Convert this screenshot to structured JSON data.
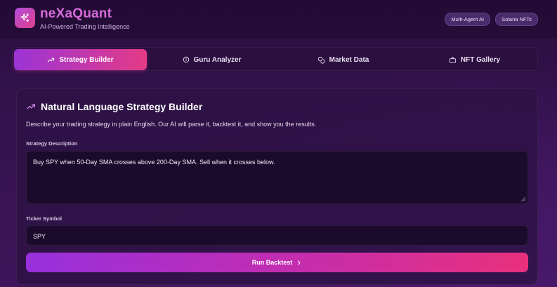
{
  "header": {
    "brand": "neXaQuant",
    "tagline": "AI-Powered Trading Intelligence",
    "logo_icon": "sparkles-icon",
    "badges": [
      "Multi-Agent AI",
      "Solana NFTs"
    ]
  },
  "tabs": [
    {
      "label": "Strategy Builder",
      "icon": "trending-up-icon",
      "active": true
    },
    {
      "label": "Guru Analyzer",
      "icon": "info-icon",
      "active": false
    },
    {
      "label": "Market Data",
      "icon": "coins-icon",
      "active": false
    },
    {
      "label": "NFT Gallery",
      "icon": "gallery-icon",
      "active": false
    }
  ],
  "panel": {
    "title": "Natural Language Strategy Builder",
    "description": "Describe your trading strategy in plain English. Our AI will parse it, backtest it, and show you the results.",
    "strategy_label": "Strategy Description",
    "strategy_value": "Buy SPY when 50-Day SMA crosses above 200-Day SMA. Sell when it crosses below.",
    "ticker_label": "Ticker Symbol",
    "ticker_value": "SPY",
    "run_button": "Run Backtest"
  },
  "colors": {
    "accent_start": "#9b34d6",
    "accent_end": "#e43b86",
    "brand_text": "#d56ad8"
  }
}
